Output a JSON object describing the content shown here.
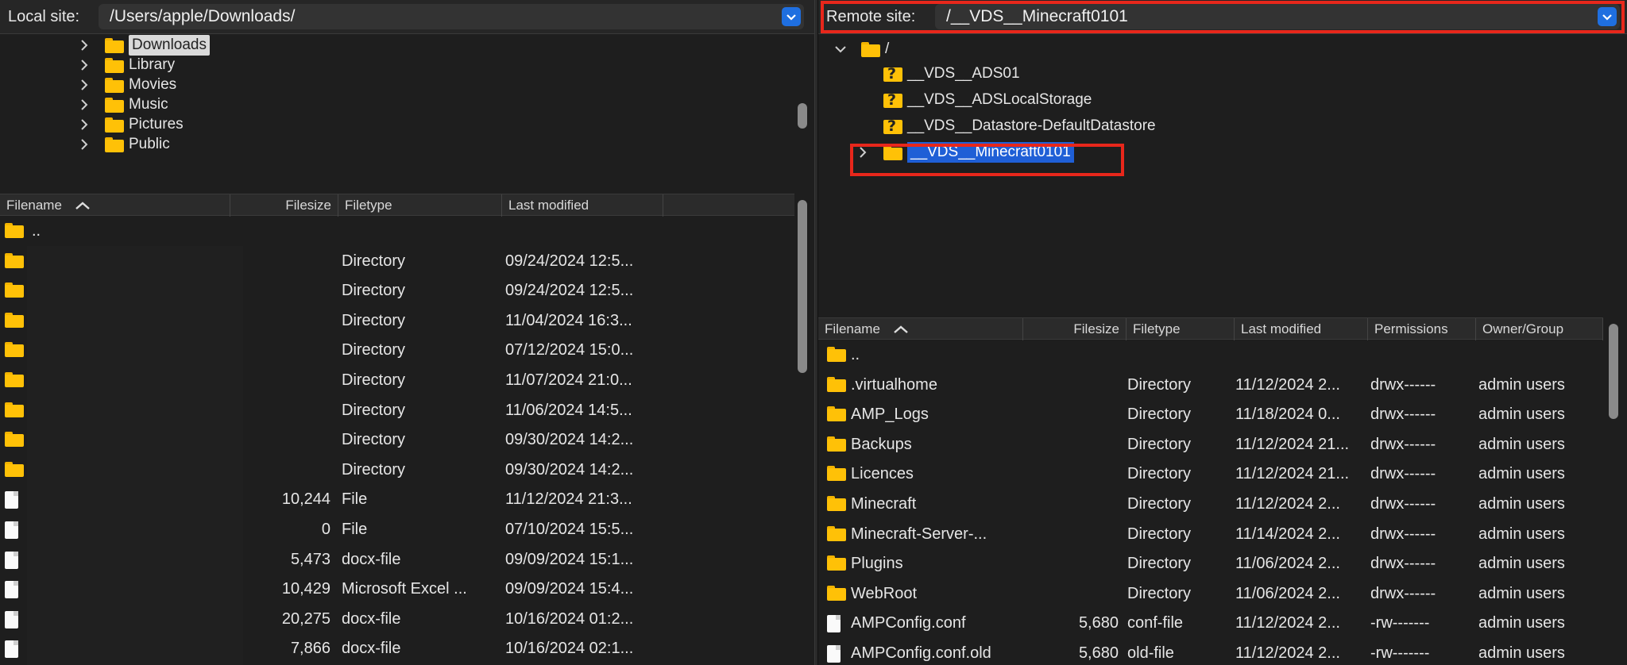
{
  "local": {
    "site_label": "Local site:",
    "path": "/Users/apple/Downloads/",
    "tree": [
      {
        "label": "Downloads",
        "selected": true
      },
      {
        "label": "Library"
      },
      {
        "label": "Movies"
      },
      {
        "label": "Music"
      },
      {
        "label": "Pictures"
      },
      {
        "label": "Public"
      }
    ],
    "columns": {
      "filename": "Filename",
      "filesize": "Filesize",
      "filetype": "Filetype",
      "modified": "Last modified"
    },
    "rows": [
      {
        "icon": "folder",
        "name": "..",
        "size": "",
        "type": "",
        "modified": ""
      },
      {
        "icon": "folder",
        "name": "",
        "size": "",
        "type": "Directory",
        "modified": "09/24/2024 12:5..."
      },
      {
        "icon": "folder",
        "name": "",
        "size": "",
        "type": "Directory",
        "modified": "09/24/2024 12:5..."
      },
      {
        "icon": "folder",
        "name": "",
        "size": "",
        "type": "Directory",
        "modified": "11/04/2024 16:3..."
      },
      {
        "icon": "folder",
        "name": "",
        "size": "",
        "type": "Directory",
        "modified": "07/12/2024 15:0..."
      },
      {
        "icon": "folder",
        "name": "",
        "size": "",
        "type": "Directory",
        "modified": "11/07/2024 21:0..."
      },
      {
        "icon": "folder",
        "name": "",
        "size": "",
        "type": "Directory",
        "modified": "11/06/2024 14:5..."
      },
      {
        "icon": "folder",
        "name": "",
        "size": "",
        "type": "Directory",
        "modified": "09/30/2024 14:2..."
      },
      {
        "icon": "folder",
        "name": "",
        "size": "",
        "type": "Directory",
        "modified": "09/30/2024 14:2..."
      },
      {
        "icon": "file",
        "name": "",
        "size": "10,244",
        "type": "File",
        "modified": "11/12/2024 21:3..."
      },
      {
        "icon": "file",
        "name": "",
        "size": "0",
        "type": "File",
        "modified": "07/10/2024 15:5..."
      },
      {
        "icon": "file",
        "name": "",
        "size": "5,473",
        "type": "docx-file",
        "modified": "09/09/2024 15:1..."
      },
      {
        "icon": "file",
        "name": "",
        "size": "10,429",
        "type": "Microsoft Excel ...",
        "modified": "09/09/2024 15:4..."
      },
      {
        "icon": "file",
        "name": "",
        "size": "20,275",
        "type": "docx-file",
        "modified": "10/16/2024 01:2..."
      },
      {
        "icon": "file",
        "name": "",
        "size": "7,866",
        "type": "docx-file",
        "modified": "10/16/2024 02:1..."
      }
    ]
  },
  "remote": {
    "site_label": "Remote site:",
    "path": "/__VDS__Minecraft0101",
    "tree_root": "/",
    "tree": [
      {
        "label": "__VDS__ADS01",
        "unknown": true
      },
      {
        "label": "__VDS__ADSLocalStorage",
        "unknown": true
      },
      {
        "label": "__VDS__Datastore-DefaultDatastore",
        "unknown": true
      },
      {
        "label": "__VDS__Minecraft0101",
        "selected": true
      }
    ],
    "columns": {
      "filename": "Filename",
      "filesize": "Filesize",
      "filetype": "Filetype",
      "modified": "Last modified",
      "permissions": "Permissions",
      "owner": "Owner/Group"
    },
    "rows": [
      {
        "icon": "folder",
        "name": "..",
        "size": "",
        "type": "",
        "modified": "",
        "perms": "",
        "owner": ""
      },
      {
        "icon": "folder",
        "name": ".virtualhome",
        "size": "",
        "type": "Directory",
        "modified": "11/12/2024 2...",
        "perms": "drwx------",
        "owner": "admin users"
      },
      {
        "icon": "folder",
        "name": "AMP_Logs",
        "size": "",
        "type": "Directory",
        "modified": "11/18/2024 0...",
        "perms": "drwx------",
        "owner": "admin users"
      },
      {
        "icon": "folder",
        "name": "Backups",
        "size": "",
        "type": "Directory",
        "modified": "11/12/2024 21...",
        "perms": "drwx------",
        "owner": "admin users"
      },
      {
        "icon": "folder",
        "name": "Licences",
        "size": "",
        "type": "Directory",
        "modified": "11/12/2024 21...",
        "perms": "drwx------",
        "owner": "admin users"
      },
      {
        "icon": "folder",
        "name": "Minecraft",
        "size": "",
        "type": "Directory",
        "modified": "11/12/2024 2...",
        "perms": "drwx------",
        "owner": "admin users"
      },
      {
        "icon": "folder",
        "name": "Minecraft-Server-...",
        "size": "",
        "type": "Directory",
        "modified": "11/14/2024 2...",
        "perms": "drwx------",
        "owner": "admin users"
      },
      {
        "icon": "folder",
        "name": "Plugins",
        "size": "",
        "type": "Directory",
        "modified": "11/06/2024 2...",
        "perms": "drwx------",
        "owner": "admin users"
      },
      {
        "icon": "folder",
        "name": "WebRoot",
        "size": "",
        "type": "Directory",
        "modified": "11/06/2024 2...",
        "perms": "drwx------",
        "owner": "admin users"
      },
      {
        "icon": "file",
        "name": "AMPConfig.conf",
        "size": "5,680",
        "type": "conf-file",
        "modified": "11/12/2024 2...",
        "perms": "-rw-------",
        "owner": "admin users"
      },
      {
        "icon": "file",
        "name": "AMPConfig.conf.old",
        "size": "5,680",
        "type": "old-file",
        "modified": "11/12/2024 2...",
        "perms": "-rw-------",
        "owner": "admin users"
      }
    ]
  },
  "colors": {
    "accent": "#1f6fe0",
    "highlight": "#e8271b",
    "folder": "#ffc107"
  }
}
